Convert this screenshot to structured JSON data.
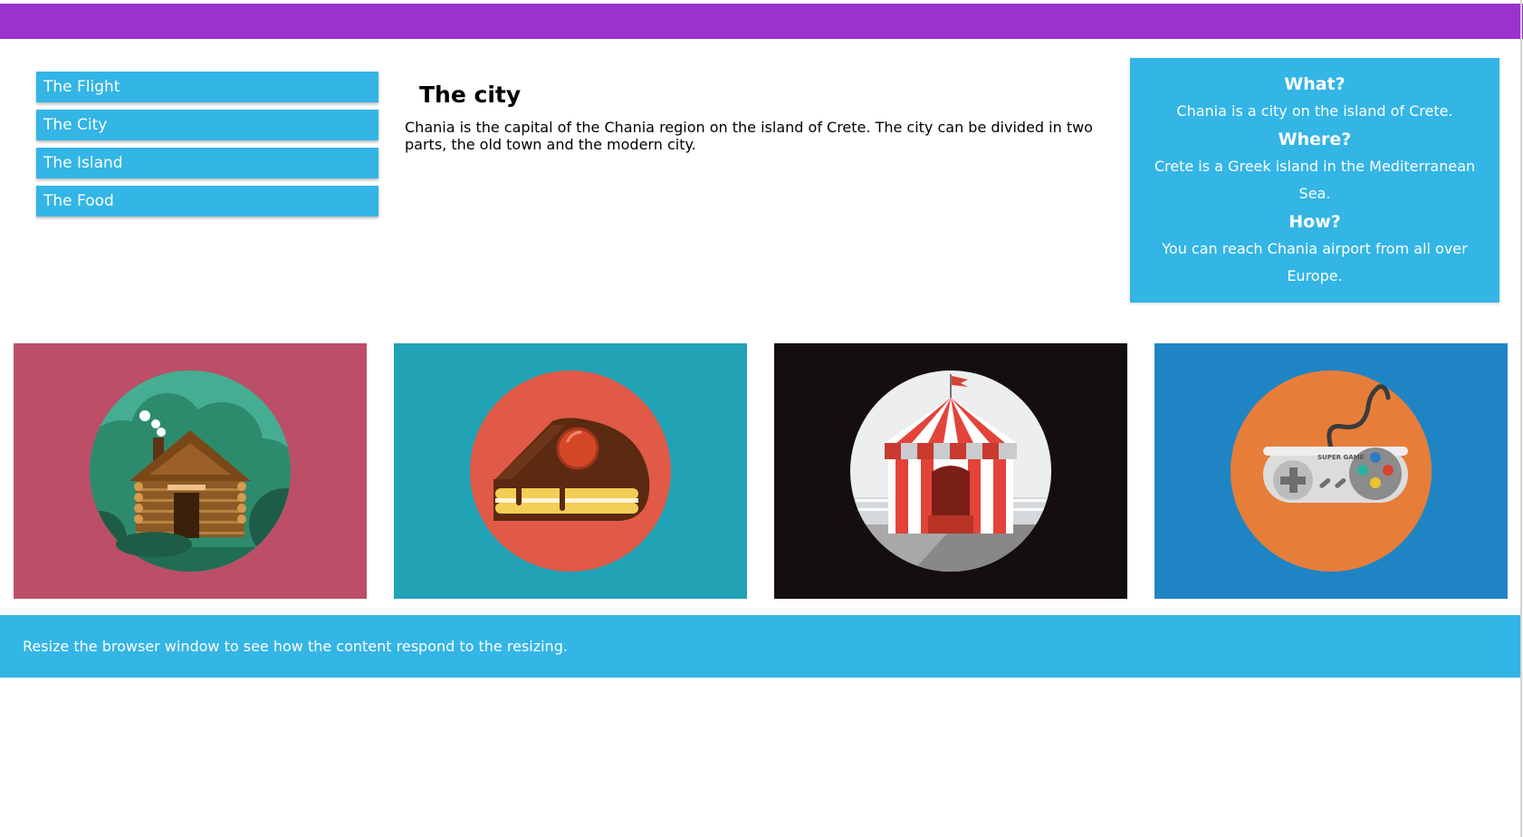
{
  "menu": {
    "items": [
      {
        "label": "The Flight"
      },
      {
        "label": "The City"
      },
      {
        "label": "The Island"
      },
      {
        "label": "The Food"
      }
    ]
  },
  "main": {
    "title": "The city",
    "text": "Chania is the capital of the Chania region on the island of Crete. The city can be divided in two parts, the old town and the modern city."
  },
  "aside": {
    "what_heading": "What?",
    "what_text": "Chania is a city on the island of Crete.",
    "where_heading": "Where?",
    "where_text": "Crete is a Greek island in the Mediterranean Sea.",
    "how_heading": "How?",
    "how_text": "You can reach Chania airport from all over Europe."
  },
  "cards": [
    {
      "icon": "log-cabin-icon",
      "bg": "#bc4f67"
    },
    {
      "icon": "cake-slice-icon",
      "bg": "#21a2b5"
    },
    {
      "icon": "circus-tent-icon",
      "bg": "#140f0e"
    },
    {
      "icon": "game-controller-icon",
      "bg": "#1f84c4",
      "brand_text": "SUPER GAME"
    }
  ],
  "footer": {
    "text": "Resize the browser window to see how the content respond to the resizing."
  },
  "colors": {
    "header": "#9933cc",
    "accent": "#33b5e5"
  }
}
